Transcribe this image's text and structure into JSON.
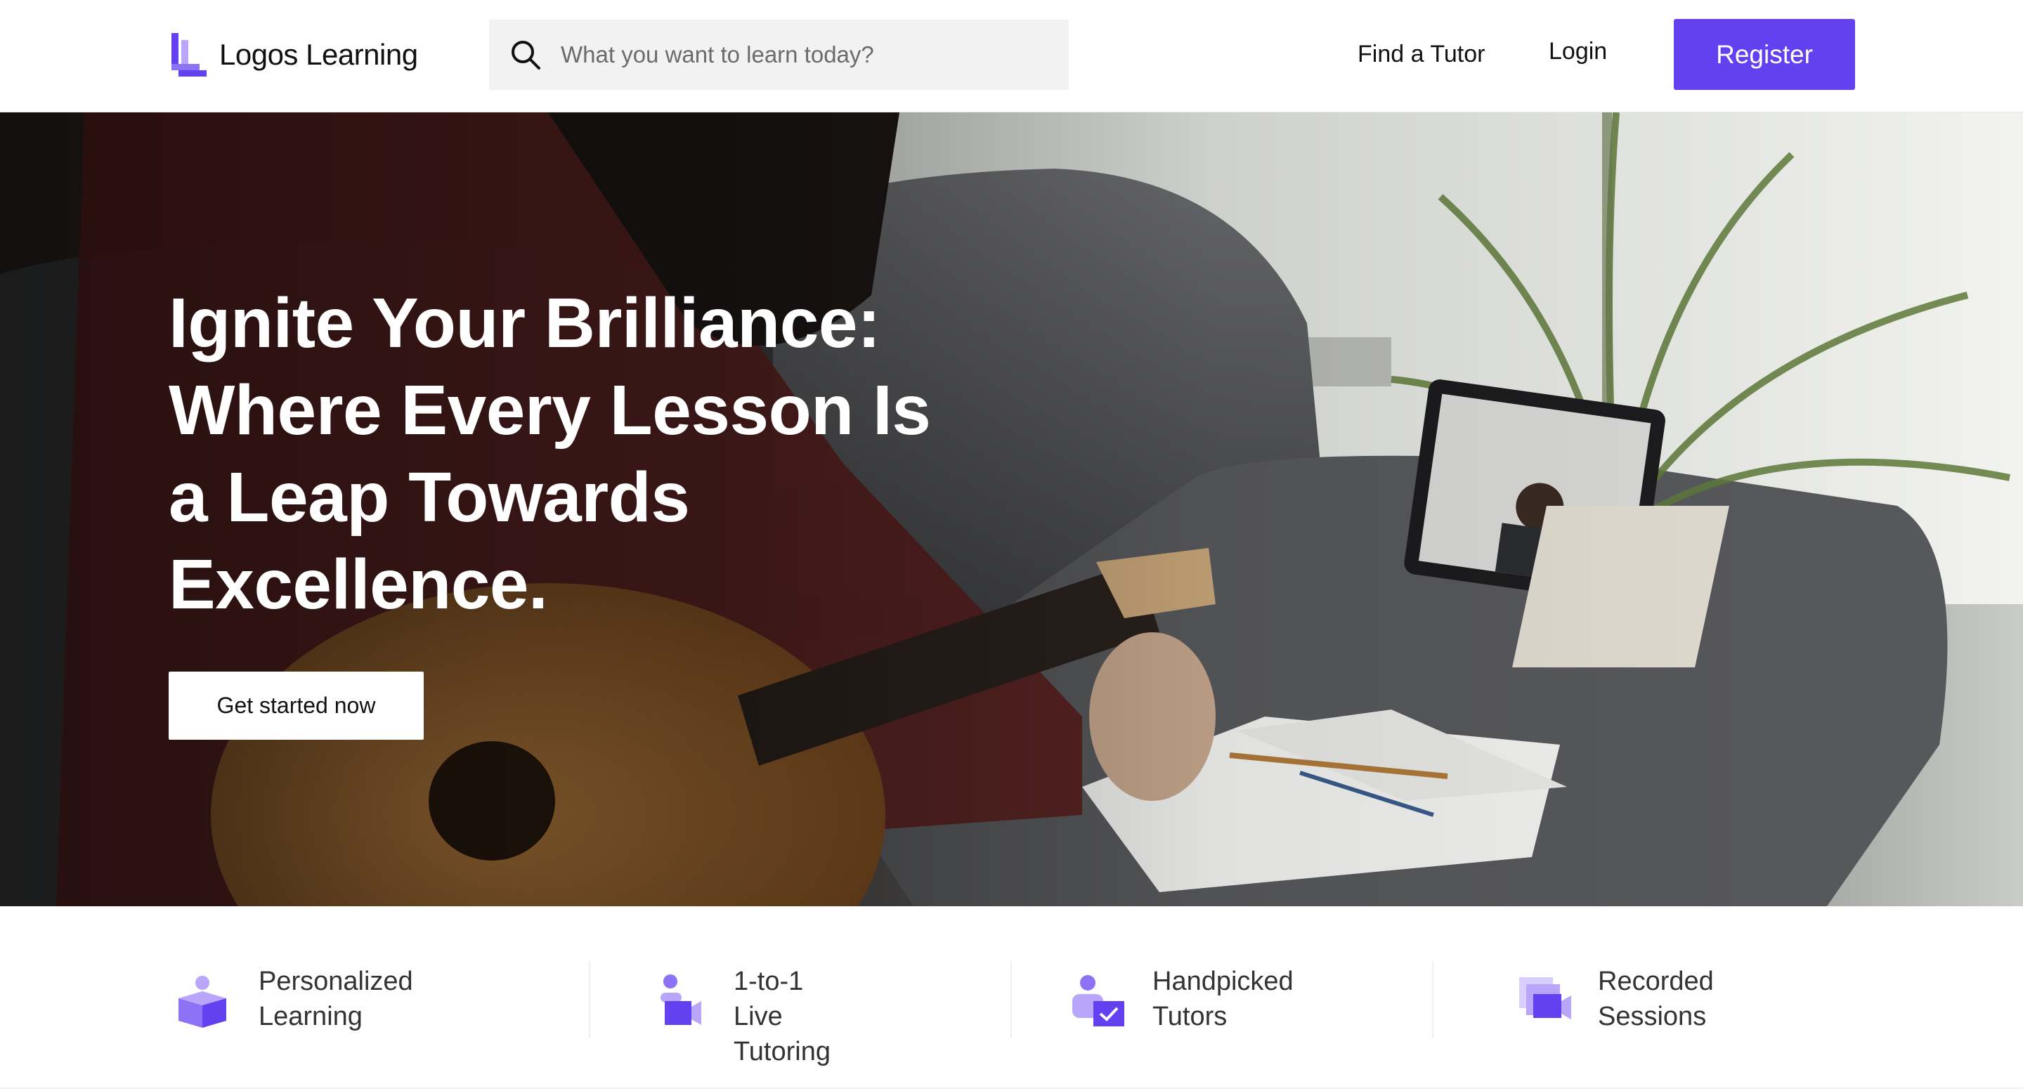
{
  "header": {
    "logo_text": "Logos Learning",
    "search_placeholder": "What you want to learn today?",
    "nav": {
      "find_tutor": "Find a Tutor",
      "login": "Login",
      "register": "Register"
    },
    "icons": {
      "logo": "logos-logo-icon",
      "search": "search-icon"
    }
  },
  "hero": {
    "title_lines": [
      "Ignite Your Brilliance:",
      "Where Every Lesson Is",
      "a Leap Towards",
      "Excellence."
    ],
    "cta": "Get started now"
  },
  "features": [
    {
      "line1": "Personalized",
      "line2": "Learning",
      "icon": "personalized-learning-icon"
    },
    {
      "line1": "1-to-1",
      "line2": "Live Tutoring",
      "icon": "live-tutoring-icon"
    },
    {
      "line1": "Handpicked",
      "line2": "Tutors",
      "icon": "handpicked-tutors-icon"
    },
    {
      "line1": "Recorded",
      "line2": "Sessions",
      "icon": "recorded-sessions-icon"
    }
  ],
  "colors": {
    "brand": "#6441f0",
    "brand_light": "#b9a6fb",
    "text_dark": "#111111",
    "text_muted": "#333333",
    "search_bg": "#f2f2f2"
  }
}
